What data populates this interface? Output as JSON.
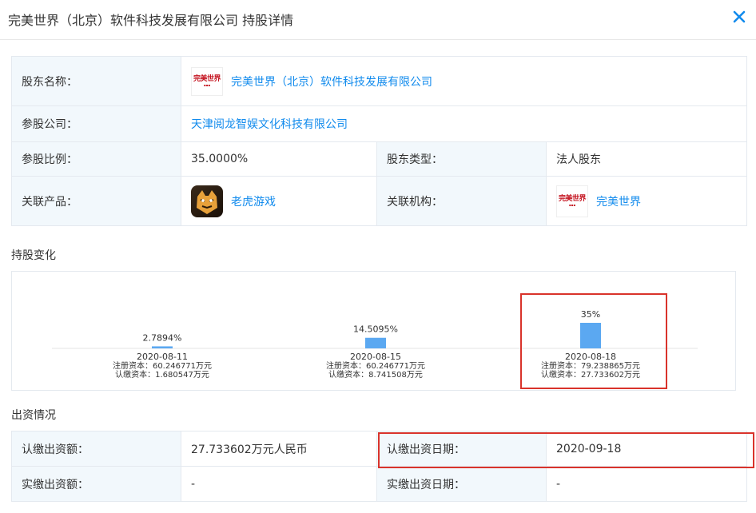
{
  "header": {
    "title": "完美世界（北京）软件科技发展有限公司 持股详情",
    "close_icon": "close-icon"
  },
  "info": {
    "shareholder_label": "股东名称：",
    "shareholder_name": "完美世界（北京）软件科技发展有限公司",
    "investee_label": "参股公司：",
    "investee_name": "天津阅龙智娱文化科技有限公司",
    "ratio_label": "参股比例：",
    "ratio_value": "35.0000%",
    "type_label": "股东类型：",
    "type_value": "法人股东",
    "product_label": "关联产品：",
    "product_name": "老虎游戏",
    "org_label": "关联机构：",
    "org_name": "完美世界",
    "logo_text": "完美世界"
  },
  "chart_title": "持股变化",
  "chart_data": {
    "type": "bar",
    "categories": [
      "2020-08-11",
      "2020-08-15",
      "2020-08-18"
    ],
    "values": [
      2.7894,
      14.5095,
      35
    ],
    "value_labels": [
      "2.7894%",
      "14.5095%",
      "35%"
    ],
    "details": [
      [
        "注册资本：60.246771万元",
        "认缴资本：1.680547万元"
      ],
      [
        "注册资本：60.246771万元",
        "认缴资本：8.741508万元"
      ],
      [
        "注册资本：79.238865万元",
        "认缴资本：27.733602万元"
      ]
    ],
    "bar_color": "#5ba8f1"
  },
  "invest_title": "出资情况",
  "invest": {
    "subscribed_amount_label": "认缴出资额：",
    "subscribed_amount_value": "27.733602万元人民币",
    "subscribed_date_label": "认缴出资日期：",
    "subscribed_date_value": "2020-09-18",
    "paid_amount_label": "实缴出资额：",
    "paid_amount_value": "-",
    "paid_date_label": "实缴出资日期：",
    "paid_date_value": "-"
  },
  "colors": {
    "link": "#128bed",
    "label_bg": "#f2f8fc",
    "highlight": "#d9332b"
  }
}
